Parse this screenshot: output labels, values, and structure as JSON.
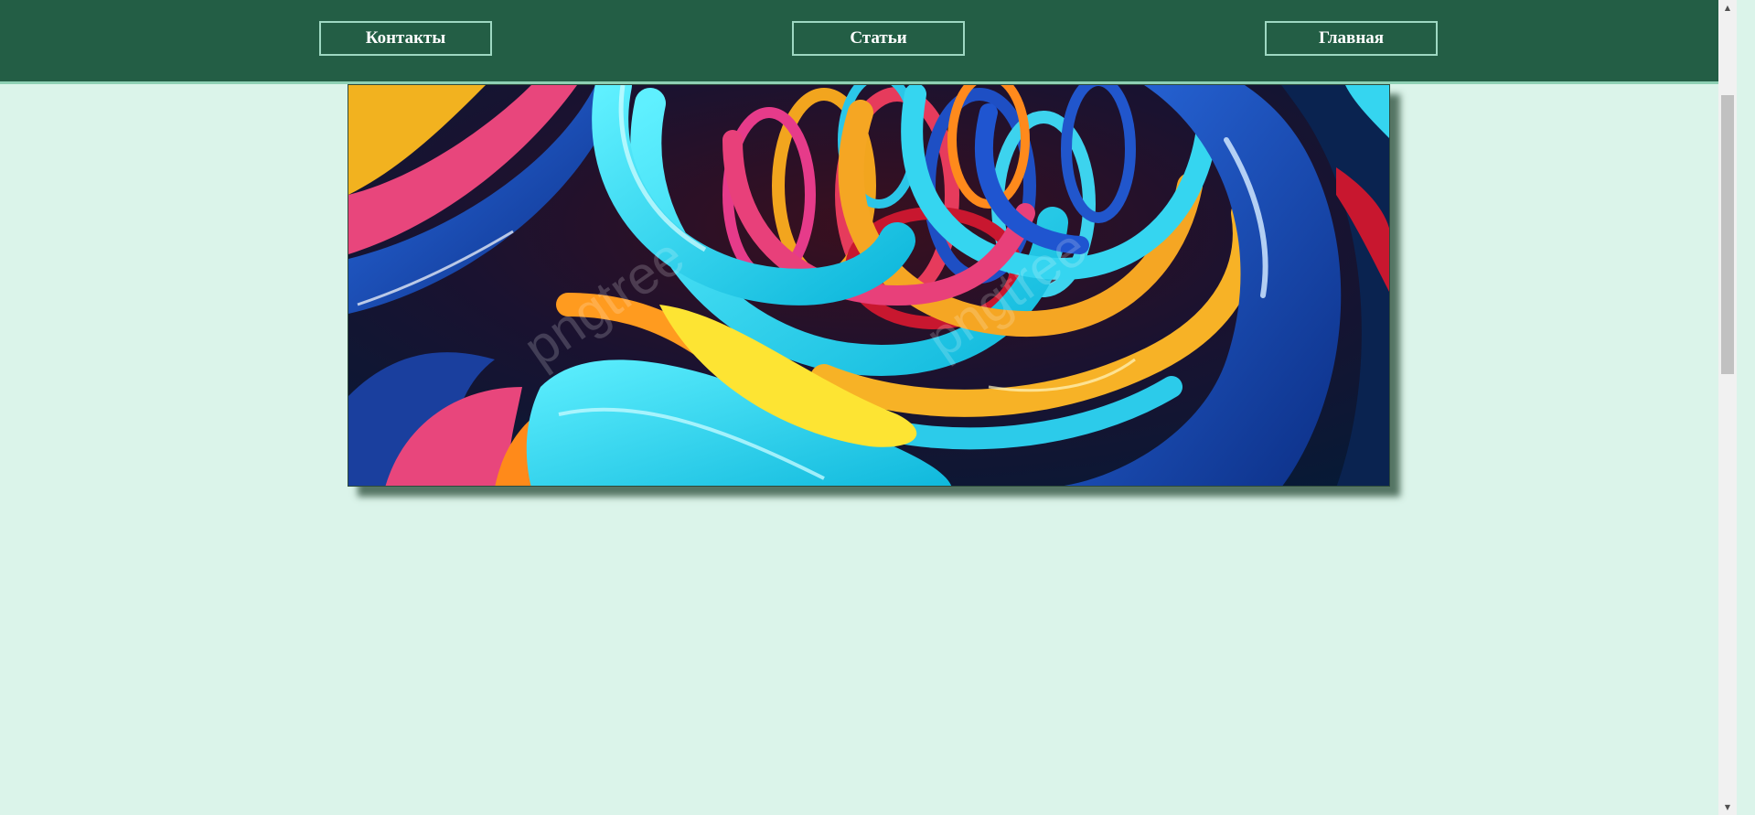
{
  "nav": {
    "items": [
      {
        "label": "Контакты"
      },
      {
        "label": "Статьи"
      },
      {
        "label": "Главная"
      }
    ]
  },
  "hero": {
    "watermark": "pngtree"
  },
  "colors": {
    "header_bg": "#235e45",
    "page_bg": "#dbf4ea",
    "button_border": "#9ed8c2"
  },
  "icons": {
    "scroll_up": "▲",
    "scroll_down": "▼"
  }
}
